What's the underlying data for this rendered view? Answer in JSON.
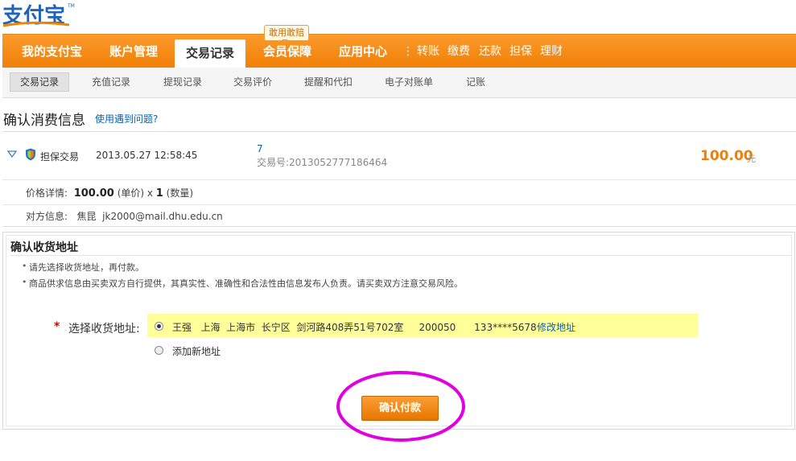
{
  "logo": {
    "text": "支付宝",
    "tm": "TM"
  },
  "nav": {
    "items": [
      "我的支付宝",
      "账户管理",
      "交易记录",
      "会员保障",
      "应用中心"
    ],
    "active": "交易记录",
    "bubble": "敢用敢赔",
    "quick": [
      "转账",
      "缴费",
      "还款",
      "担保",
      "理财"
    ]
  },
  "subnav": {
    "items": [
      "交易记录",
      "充值记录",
      "提现记录",
      "交易评价",
      "提醒和代扣",
      "电子对账单",
      "记账"
    ],
    "active": "交易记录"
  },
  "confirm": {
    "title": "确认消费信息",
    "help": "使用遇到问题?"
  },
  "trade": {
    "type": "担保交易",
    "time": "2013.05.27 12:58:45",
    "name": "7",
    "no_label": "交易号:",
    "no": "2013052777186464",
    "amount": "100.00",
    "unit": "元",
    "price_label": "价格详情:",
    "unit_price": "100.00",
    "unit_price_suffix": "(单价) x",
    "quantity": "1",
    "quantity_suffix": "(数量)",
    "party_label": "对方信息:",
    "party_name": "焦昆",
    "party_email": "jk2000@mail.dhu.edu.cn"
  },
  "address": {
    "title": "确认收货地址",
    "tips": [
      "请先选择收货地址，再付款。",
      "商品供求信息由买卖双方自行提供，其真实性、准确性和合法性由信息发布人负责。请买卖双方注意交易风险。"
    ],
    "required": "*",
    "select_label": "选择收货地址:",
    "existing": "王强   上海  上海市  长宁区  剑河路408弄51号702室     200050      133****5678",
    "edit": "修改地址",
    "add_new": "添加新地址",
    "pay_button": "确认付款"
  },
  "colors": {
    "brand_orange": "#f08300",
    "link_blue": "#0b62b3",
    "highlight": "#ffff9a",
    "annotation": "#e000e0"
  }
}
